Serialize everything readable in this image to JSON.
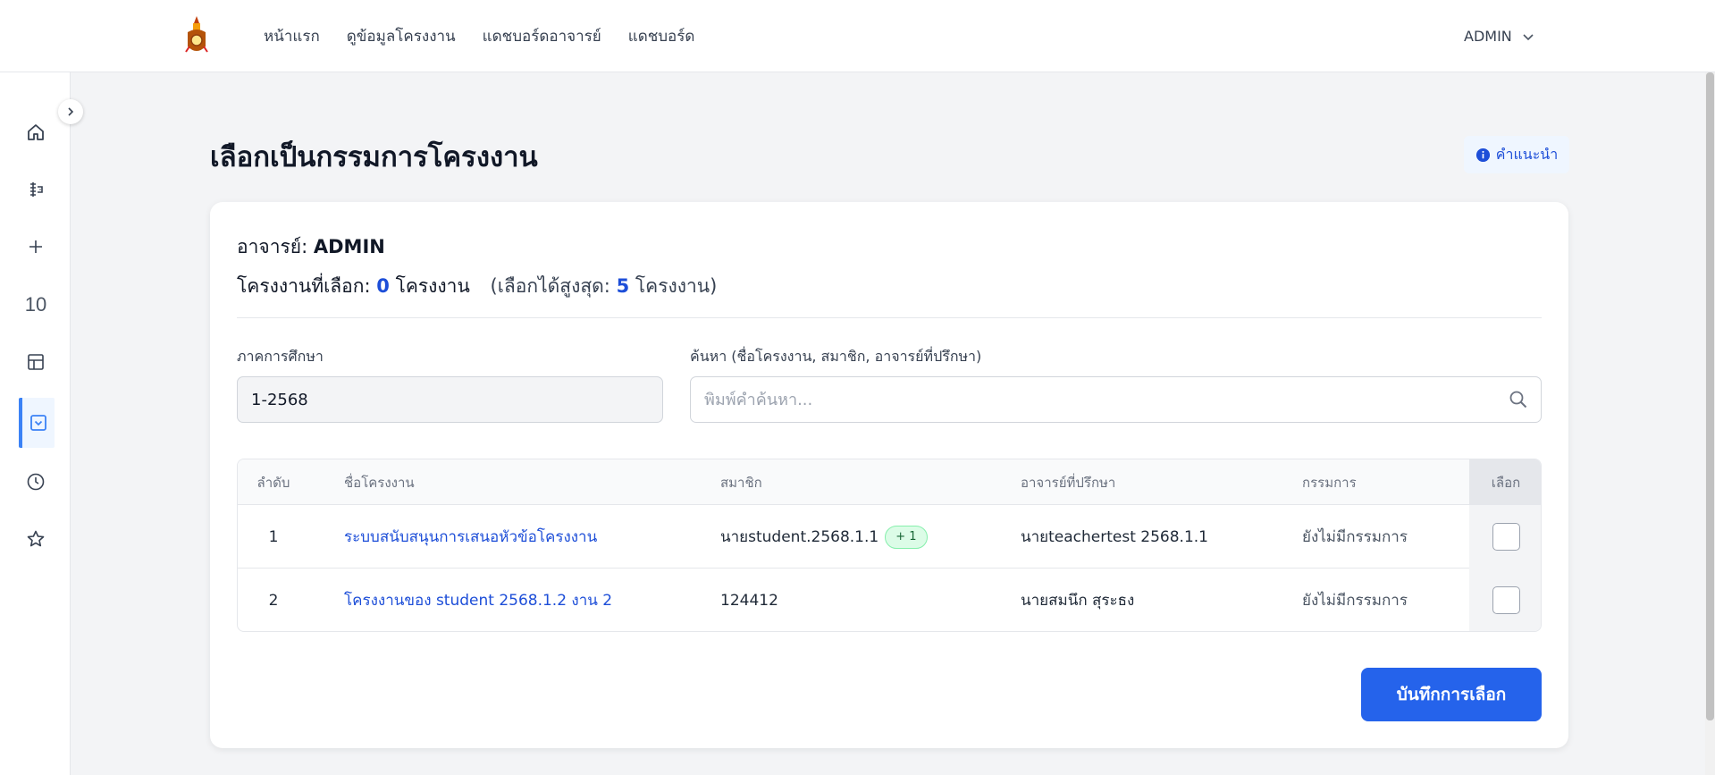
{
  "nav": {
    "links": [
      "หน้าแรก",
      "ดูข้อมูลโครงงาน",
      "แดชบอร์ดอาจารย์",
      "แดชบอร์ด"
    ],
    "user": "ADMIN"
  },
  "sidebar": {
    "items": [
      {
        "icon": "home-icon"
      },
      {
        "icon": "project-icon"
      },
      {
        "icon": "plus-icon"
      },
      {
        "icon": "number-icon",
        "label": "10"
      },
      {
        "icon": "table-icon"
      },
      {
        "icon": "select-box-icon",
        "active": true
      },
      {
        "icon": "clock-icon"
      },
      {
        "icon": "star-icon"
      }
    ]
  },
  "page": {
    "title": "เลือกเป็นกรรมการโครงงาน",
    "help_label": "คำแนะนำ"
  },
  "summary": {
    "teacher_label": "อาจารย์:",
    "teacher_name": "ADMIN",
    "selected_label": "โครงงานที่เลือก:",
    "selected_count": "0",
    "unit": "โครงงาน",
    "max_prefix": "(เลือกได้สูงสุด:",
    "max_count": "5",
    "max_suffix": "โครงงาน)"
  },
  "filters": {
    "semester_label": "ภาคการศึกษา",
    "semester_value": "1-2568",
    "search_label": "ค้นหา (ชื่อโครงงาน, สมาชิก, อาจารย์ที่ปรึกษา)",
    "search_placeholder": "พิมพ์คำค้นหา..."
  },
  "table": {
    "headers": {
      "index": "ลำดับ",
      "name": "ชื่อโครงงาน",
      "members": "สมาชิก",
      "advisor": "อาจารย์ที่ปรึกษา",
      "committee": "กรรมการ",
      "select": "เลือก"
    },
    "rows": [
      {
        "index": "1",
        "name": "ระบบสนับสนุนการเสนอหัวข้อโครงงาน",
        "members": "นายstudent.2568.1.1",
        "extra": "+ 1",
        "advisor": "นายteachertest 2568.1.1",
        "committee": "ยังไม่มีกรรมการ"
      },
      {
        "index": "2",
        "name": "โครงงานของ student 2568.1.2 งาน 2",
        "members": "124412",
        "advisor": "นายสมนึก สุระธง",
        "committee": "ยังไม่มีกรรมการ"
      }
    ]
  },
  "actions": {
    "save_label": "บันทึกการเลือก"
  },
  "colors": {
    "primary": "#2563eb",
    "link": "#1d4ed8",
    "badge_bg": "#dcfce7"
  }
}
